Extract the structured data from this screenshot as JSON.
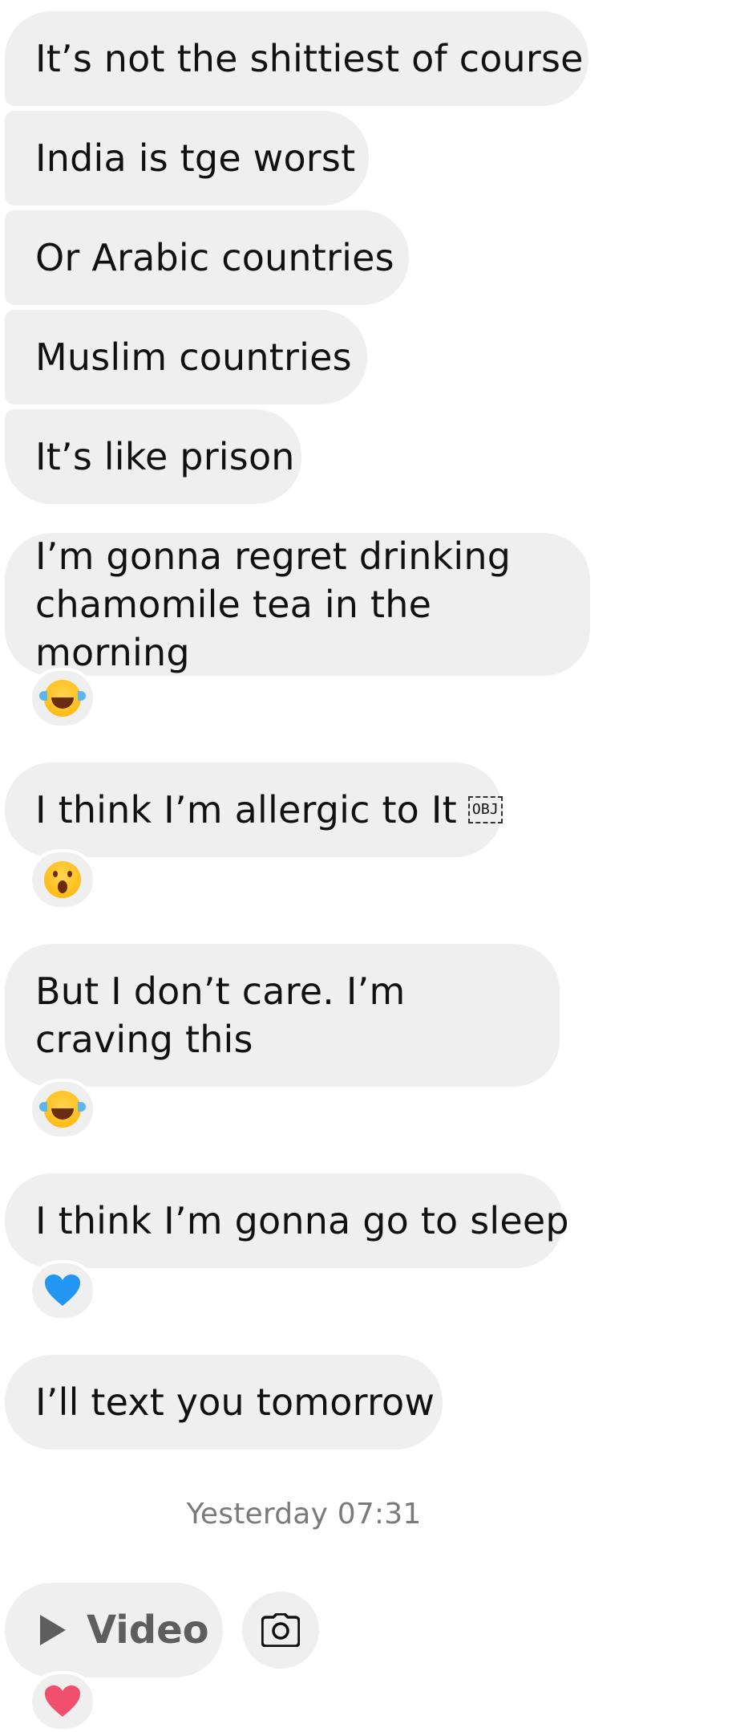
{
  "messages": [
    {
      "text": "It’s not the shittiest of course"
    },
    {
      "text": "India is tge worst"
    },
    {
      "text": "Or Arabic countries"
    },
    {
      "text": "Muslim countries"
    },
    {
      "text": "It’s like prison"
    },
    {
      "text": "I’m gonna regret drinking chamomile tea in the morning",
      "reaction": "face-with-tears-of-joy-icon"
    },
    {
      "text": "I think I’m allergic to It",
      "attachment_glyph": "OBJ",
      "reaction": "astonished-face-icon"
    },
    {
      "text": "But I don’t care. I’m craving this",
      "reaction": "face-with-tears-of-joy-icon"
    },
    {
      "text": "I think I’m gonna go to sleep",
      "reaction": "blue-heart-icon"
    },
    {
      "text": "I’ll text you tomorrow"
    }
  ],
  "timestamp": "Yesterday 07:31",
  "video_message": {
    "label": "Video",
    "reaction": "red-heart-icon"
  },
  "colors": {
    "bubble": "#efefef",
    "text": "#111111",
    "timestamp": "#7a7a7a",
    "blue_heart": "#2196f3",
    "red_heart": "#f0506e"
  }
}
